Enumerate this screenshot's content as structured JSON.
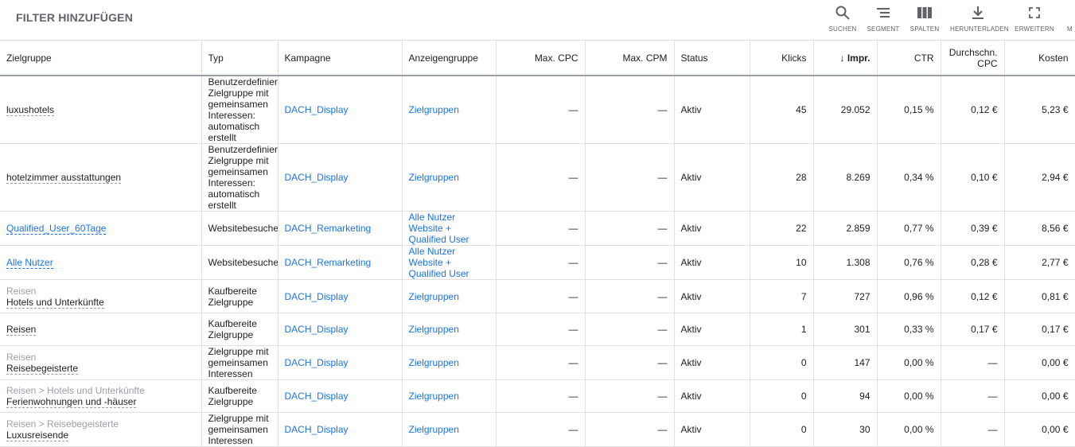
{
  "toolbar": {
    "filter_label": "FILTER HINZUFÜGEN",
    "tools": [
      {
        "label": "SUCHEN",
        "icon": "search-icon"
      },
      {
        "label": "SEGMENT",
        "icon": "segment-icon"
      },
      {
        "label": "SPALTEN",
        "icon": "columns-icon"
      },
      {
        "label": "HERUNTERLADEN",
        "icon": "download-icon"
      },
      {
        "label": "ERWEITERN",
        "icon": "expand-icon"
      },
      {
        "label": "M",
        "icon": "more-icon"
      }
    ]
  },
  "table": {
    "sort_arrow": "↓",
    "headers": {
      "zielgruppe": "Zielgruppe",
      "typ": "Typ",
      "kampagne": "Kampagne",
      "anzeigengruppe": "Anzeigengruppe",
      "max_cpc": "Max. CPC",
      "max_cpm": "Max. CPM",
      "status": "Status",
      "klicks": "Klicks",
      "impr": "Impr.",
      "ctr": "CTR",
      "cpc_line1": "Durchschn.",
      "cpc_line2": "CPC",
      "kosten": "Kosten"
    },
    "rows": [
      {
        "parent": "",
        "name": "luxushotels",
        "name_link": false,
        "typ": [
          "Benutzerdefinier",
          "Zielgruppe mit",
          "gemeinsamen",
          "Interessen:",
          "automatisch",
          "erstellt"
        ],
        "kampagne": "DACH_Display",
        "anzeigengruppe": [
          "Zielgruppen"
        ],
        "max_cpc": "—",
        "max_cpm": "—",
        "status": "Aktiv",
        "klicks": "45",
        "impr": "29.052",
        "ctr": "0,15 %",
        "cpc": "0,12 €",
        "kosten": "5,23 €"
      },
      {
        "parent": "",
        "name": "hotelzimmer ausstattungen",
        "name_link": false,
        "typ": [
          "Benutzerdefinier",
          "Zielgruppe mit",
          "gemeinsamen",
          "Interessen:",
          "automatisch",
          "erstellt"
        ],
        "kampagne": "DACH_Display",
        "anzeigengruppe": [
          "Zielgruppen"
        ],
        "max_cpc": "—",
        "max_cpm": "—",
        "status": "Aktiv",
        "klicks": "28",
        "impr": "8.269",
        "ctr": "0,34 %",
        "cpc": "0,10 €",
        "kosten": "2,94 €"
      },
      {
        "parent": "",
        "name": "Qualified_User_60Tage",
        "name_link": true,
        "typ": [
          "Websitebesuche"
        ],
        "kampagne": "DACH_Remarketing",
        "anzeigengruppe": [
          "Alle Nutzer",
          "Website +",
          "Qualified User"
        ],
        "max_cpc": "—",
        "max_cpm": "—",
        "status": "Aktiv",
        "klicks": "22",
        "impr": "2.859",
        "ctr": "0,77 %",
        "cpc": "0,39 €",
        "kosten": "8,56 €"
      },
      {
        "parent": "",
        "name": "Alle Nutzer",
        "name_link": true,
        "typ": [
          "Websitebesuche"
        ],
        "kampagne": "DACH_Remarketing",
        "anzeigengruppe": [
          "Alle Nutzer",
          "Website +",
          "Qualified User"
        ],
        "max_cpc": "—",
        "max_cpm": "—",
        "status": "Aktiv",
        "klicks": "10",
        "impr": "1.308",
        "ctr": "0,76 %",
        "cpc": "0,28 €",
        "kosten": "2,77 €"
      },
      {
        "parent": "Reisen",
        "name": "Hotels und Unterkünfte",
        "name_link": false,
        "typ": [
          "Kaufbereite",
          "Zielgruppe"
        ],
        "kampagne": "DACH_Display",
        "anzeigengruppe": [
          "Zielgruppen"
        ],
        "max_cpc": "—",
        "max_cpm": "—",
        "status": "Aktiv",
        "klicks": "7",
        "impr": "727",
        "ctr": "0,96 %",
        "cpc": "0,12 €",
        "kosten": "0,81 €"
      },
      {
        "parent": "",
        "name": "Reisen",
        "name_link": false,
        "typ": [
          "Kaufbereite",
          "Zielgruppe"
        ],
        "kampagne": "DACH_Display",
        "anzeigengruppe": [
          "Zielgruppen"
        ],
        "max_cpc": "—",
        "max_cpm": "—",
        "status": "Aktiv",
        "klicks": "1",
        "impr": "301",
        "ctr": "0,33 %",
        "cpc": "0,17 €",
        "kosten": "0,17 €"
      },
      {
        "parent": "Reisen",
        "name": "Reisebegeisterte",
        "name_link": false,
        "typ": [
          "Zielgruppe mit",
          "gemeinsamen",
          "Interessen"
        ],
        "kampagne": "DACH_Display",
        "anzeigengruppe": [
          "Zielgruppen"
        ],
        "max_cpc": "—",
        "max_cpm": "—",
        "status": "Aktiv",
        "klicks": "0",
        "impr": "147",
        "ctr": "0,00 %",
        "cpc": "—",
        "kosten": "0,00 €"
      },
      {
        "parent": "Reisen > Hotels und Unterkünfte",
        "name": "Ferienwohnungen und -häuser",
        "name_link": false,
        "typ": [
          "Kaufbereite",
          "Zielgruppe"
        ],
        "kampagne": "DACH_Display",
        "anzeigengruppe": [
          "Zielgruppen"
        ],
        "max_cpc": "—",
        "max_cpm": "—",
        "status": "Aktiv",
        "klicks": "0",
        "impr": "94",
        "ctr": "0,00 %",
        "cpc": "—",
        "kosten": "0,00 €"
      },
      {
        "parent": "Reisen > Reisebegeisterte",
        "name": "Luxusreisende",
        "name_link": false,
        "typ": [
          "Zielgruppe mit",
          "gemeinsamen",
          "Interessen"
        ],
        "kampagne": "DACH_Display",
        "anzeigengruppe": [
          "Zielgruppen"
        ],
        "max_cpc": "—",
        "max_cpm": "—",
        "status": "Aktiv",
        "klicks": "0",
        "impr": "30",
        "ctr": "0,00 %",
        "cpc": "—",
        "kosten": "0,00 €"
      }
    ]
  }
}
